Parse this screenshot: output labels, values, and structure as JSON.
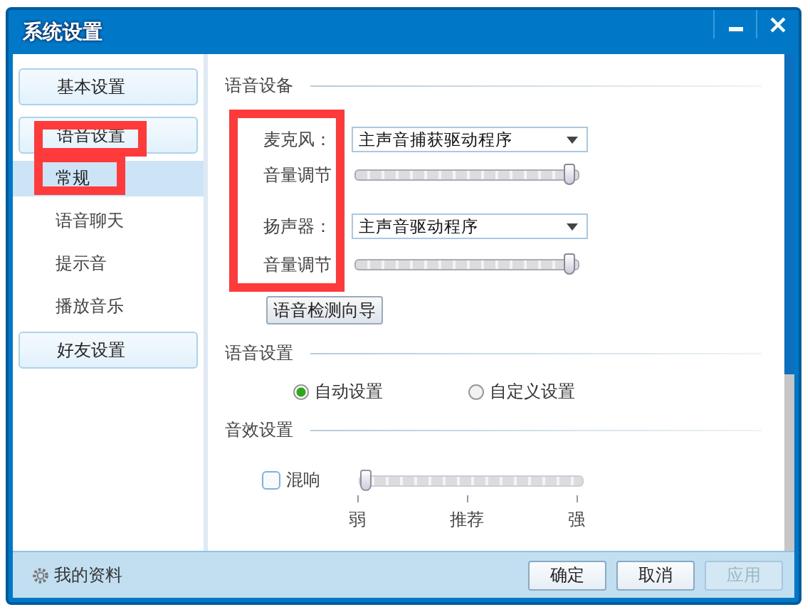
{
  "window": {
    "title": "系统设置"
  },
  "sidebar": {
    "groups": [
      {
        "label": "基本设置",
        "highlighted": false
      },
      {
        "label": "语音设置",
        "highlighted": true,
        "children": [
          {
            "label": "常规",
            "selected": true,
            "highlighted": true
          },
          {
            "label": "语音聊天",
            "selected": false,
            "highlighted": false
          },
          {
            "label": "提示音",
            "selected": false,
            "highlighted": false
          },
          {
            "label": "播放音乐",
            "selected": false,
            "highlighted": false
          }
        ]
      },
      {
        "label": "好友设置",
        "highlighted": false
      }
    ]
  },
  "voice_devices": {
    "title": "语音设备",
    "labels_highlighted": true,
    "devices": [
      {
        "label": "麦克风：",
        "value": "主声音捕获驱动程序",
        "volume_label": "音量调节",
        "level": 1.0
      },
      {
        "label": "扬声器：",
        "value": "主声音驱动程序",
        "volume_label": "音量调节",
        "level": 1.0
      }
    ],
    "wizard_button": "语音检测向导"
  },
  "voice_settings": {
    "title": "语音设置",
    "options": [
      {
        "label": "自动设置",
        "selected": true
      },
      {
        "label": "自定义设置",
        "selected": false
      }
    ]
  },
  "sound_effects": {
    "title": "音效设置",
    "effect": {
      "label": "混响",
      "checked": false,
      "level": 0.0,
      "ticks": [
        "弱",
        "推荐",
        "强"
      ]
    }
  },
  "footer": {
    "profile_link": "我的资料",
    "buttons": [
      {
        "label": "确定",
        "disabled": false
      },
      {
        "label": "取消",
        "disabled": false
      },
      {
        "label": "应用",
        "disabled": true
      }
    ]
  }
}
